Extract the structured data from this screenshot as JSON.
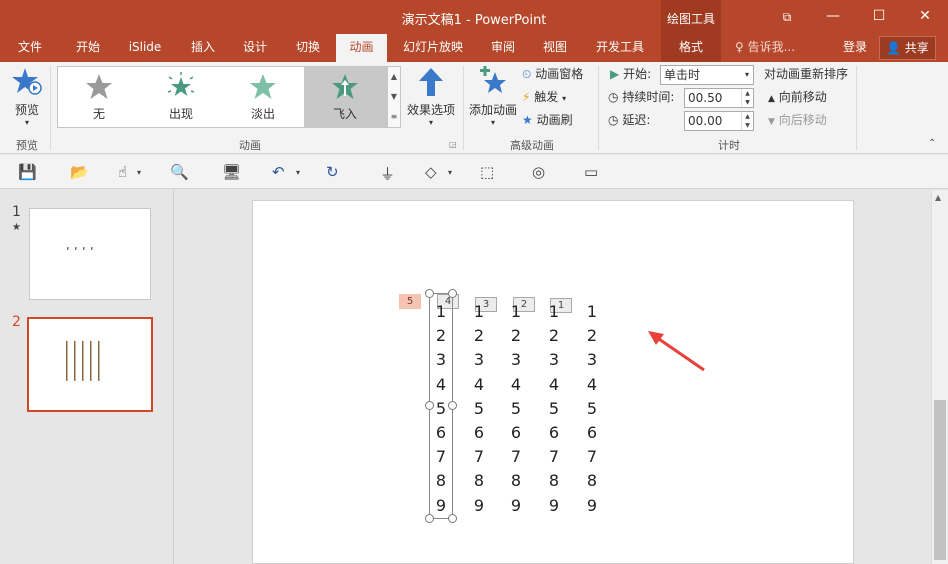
{
  "window": {
    "title": "演示文稿1 - PowerPoint",
    "context_tools": "绘图工具"
  },
  "tabs": [
    {
      "label": "文件"
    },
    {
      "label": "开始"
    },
    {
      "label": "iSlide"
    },
    {
      "label": "插入"
    },
    {
      "label": "设计"
    },
    {
      "label": "切换"
    },
    {
      "label": "动画"
    },
    {
      "label": "幻灯片放映"
    },
    {
      "label": "审阅"
    },
    {
      "label": "视图"
    },
    {
      "label": "开发工具"
    },
    {
      "label": "格式"
    }
  ],
  "tellme": "告诉我...",
  "login": "登录",
  "share": "共享",
  "ribbon": {
    "preview": {
      "button": "预览",
      "group": "预览"
    },
    "animation": {
      "group": "动画",
      "gallery": [
        {
          "label": "无"
        },
        {
          "label": "出现"
        },
        {
          "label": "淡出"
        },
        {
          "label": "飞入"
        }
      ],
      "effect_options": "效果选项"
    },
    "advanced": {
      "group": "高级动画",
      "add": "添加动画",
      "pane": "动画窗格",
      "trigger": "触发",
      "painter": "动画刷"
    },
    "timing": {
      "group": "计时",
      "start_label": "开始:",
      "start_value": "单击时",
      "duration_label": "持续时间:",
      "duration_value": "00.50",
      "delay_label": "延迟:",
      "delay_value": "00.00",
      "reorder": "对动画重新排序",
      "move_earlier": "向前移动",
      "move_later": "向后移动"
    }
  },
  "slides": [
    {
      "number": "1",
      "marker": "★"
    },
    {
      "number": "2"
    }
  ],
  "slide_content": {
    "columns": [
      [
        "1",
        "2",
        "3",
        "4",
        "5",
        "6",
        "7",
        "8",
        "9"
      ],
      [
        "1",
        "2",
        "3",
        "4",
        "5",
        "6",
        "7",
        "8",
        "9"
      ],
      [
        "1",
        "2",
        "3",
        "4",
        "5",
        "6",
        "7",
        "8",
        "9"
      ],
      [
        "1",
        "2",
        "3",
        "4",
        "5",
        "6",
        "7",
        "8",
        "9"
      ],
      [
        "1",
        "2",
        "3",
        "4",
        "5",
        "6",
        "7",
        "8",
        "9"
      ]
    ],
    "tags": [
      "5",
      "4",
      "3",
      "2",
      "1"
    ]
  },
  "colors": {
    "accent": "#b7472a",
    "selected_tag": "#f6c3b2",
    "arrow": "#e8413a"
  }
}
